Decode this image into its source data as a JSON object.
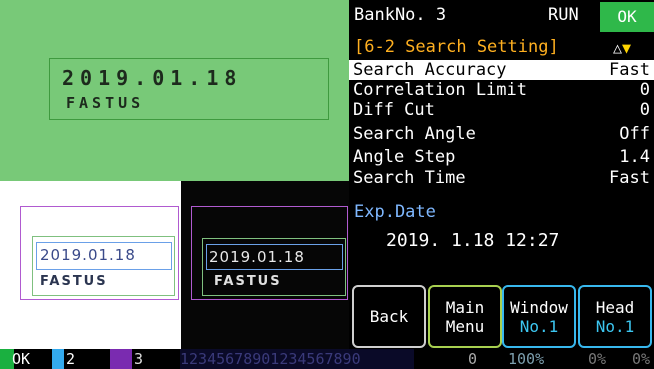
{
  "header": {
    "bank_label": "BankNo. 3",
    "run_label": "RUN",
    "ok_badge": "OK",
    "title": "[6-2 Search Setting]",
    "arrow_up": "△",
    "arrow_down": "▼"
  },
  "settings": [
    {
      "label": "Search Accuracy",
      "value": "Fast"
    },
    {
      "label": "Correlation Limit",
      "value": "0"
    },
    {
      "label": "Diff Cut",
      "value": "0"
    },
    {
      "label": "Search Angle",
      "value": "Off"
    },
    {
      "label": "Angle Step",
      "value": "1.4"
    },
    {
      "label": "Search Time",
      "value": "Fast"
    }
  ],
  "exp": {
    "label": "Exp.Date",
    "value": "2019. 1.18  12:27"
  },
  "buttons": {
    "back": "Back",
    "main_line1": "Main",
    "main_line2": "Menu",
    "window_line1": "Window",
    "window_line2": "No.1",
    "head_line1": "Head",
    "head_line2": "No.1"
  },
  "camera": {
    "top_line1": "2019.01.18",
    "top_line2": "FASTUS",
    "date_text": "2019.01.18",
    "brand_text": "FASTUS"
  },
  "status_bar": {
    "ok": "OK",
    "slot2": "2",
    "slot3": "3",
    "digits": "12345678901234567890",
    "zero": "0",
    "percent100": "100%",
    "percent0a": "0%",
    "percent0b": "0%"
  },
  "colors": {
    "ok_green": "#2fb84a",
    "title_orange": "#ffb020",
    "cyan": "#38b8ee",
    "lime": "#a8d050",
    "camera_green": "#78c978"
  }
}
